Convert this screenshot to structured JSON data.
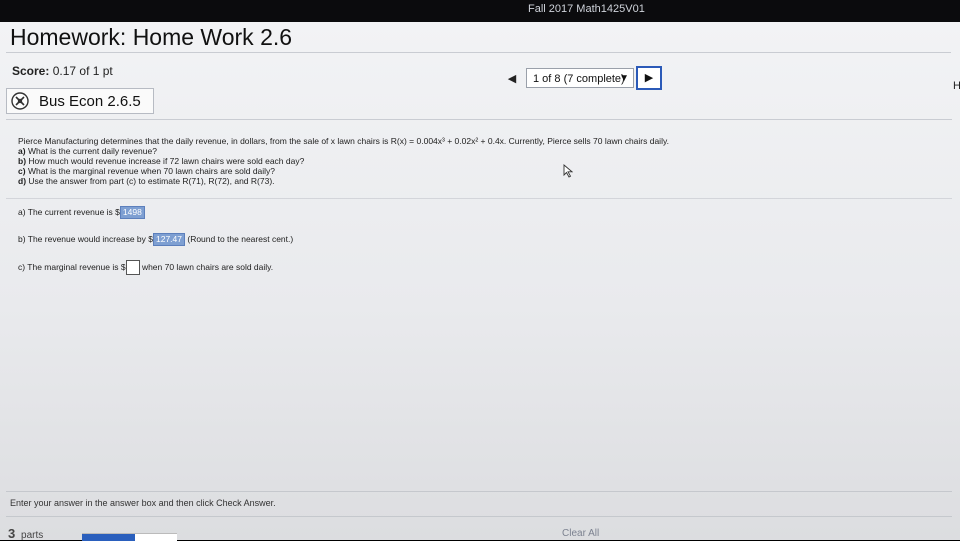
{
  "window": {
    "title": "Fall 2017 Math1425V01"
  },
  "header": {
    "title": "Homework: Home Work 2.6",
    "score_label": "Score:",
    "score_value": "0.17 of 1 pt"
  },
  "nav": {
    "prev_icon": "triangle-left",
    "progress": "1 of 8 (7 complete)",
    "next_icon": "triangle-right",
    "edge_letter": "H"
  },
  "question": {
    "title": "Bus Econ 2.6.5",
    "statement": "Pierce Manufacturing determines that the daily revenue, in dollars, from the sale of x lawn chairs is R(x) = 0.004x³ + 0.02x² + 0.4x. Currently, Pierce sells 70 lawn chairs daily.",
    "parts": [
      {
        "label": "a)",
        "text": "What is the current daily revenue?"
      },
      {
        "label": "b)",
        "text": "How much would revenue increase if 72 lawn chairs were sold each day?"
      },
      {
        "label": "c)",
        "text": "What is the marginal revenue when 70 lawn chairs are sold daily?"
      },
      {
        "label": "d)",
        "text": "Use the answer from part (c) to estimate R(71), R(72), and R(73)."
      }
    ],
    "answers": {
      "a_prefix": "a) The current revenue is $",
      "a_value": "1498",
      "b_prefix": "b) The revenue would increase by $",
      "b_value": "127.47",
      "b_suffix": "(Round to the nearest cent.)",
      "c_prefix": "c) The marginal revenue is $",
      "c_suffix": "when 70 lawn chairs are sold daily."
    }
  },
  "footer": {
    "instruction": "Enter your answer in the answer box and then click Check Answer.",
    "parts_count": "3",
    "parts_label": "parts",
    "parts_progress": 0.56,
    "clear_all": "Clear All"
  },
  "colors": {
    "accent": "#2b5ab8",
    "answer_fill": "#7e9fd2"
  }
}
